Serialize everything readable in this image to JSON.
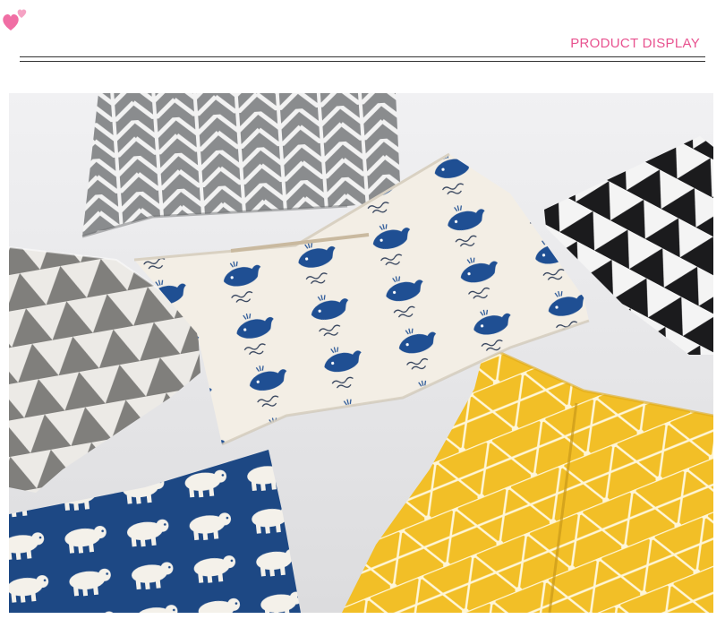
{
  "header": {
    "title": "PRODUCT DISPLAY",
    "accent_color": "#e8528f",
    "decoration": "hearts-icon"
  },
  "photo": {
    "subject": "product-photo",
    "items": [
      {
        "name": "gray-chevron-tissue-cover",
        "color": "#8b8d8e"
      },
      {
        "name": "black-triangle-tissue-cover",
        "color": "#1c1c1e"
      },
      {
        "name": "gray-triangle-tissue-cover",
        "color": "#7d7c7a"
      },
      {
        "name": "whale-print-tissue-cover",
        "color": "#f2ede4"
      },
      {
        "name": "polar-bear-tissue-cover",
        "color": "#1d4a86"
      },
      {
        "name": "yellow-geometric-tissue-cover",
        "color": "#f2c02a"
      }
    ]
  }
}
